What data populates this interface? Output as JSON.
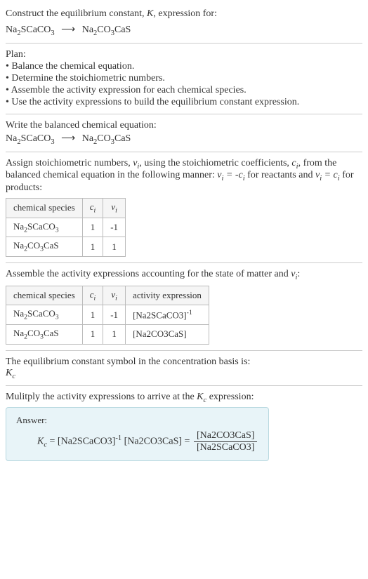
{
  "title": {
    "line1_pre": "Construct the equilibrium constant, ",
    "line1_k": "K",
    "line1_post": ", expression for:",
    "eq_lhs": "Na2SCaCO3",
    "eq_arrow": "⟶",
    "eq_rhs": "Na2CO3CaS"
  },
  "plan": {
    "heading": "Plan:",
    "items": [
      "• Balance the chemical equation.",
      "• Determine the stoichiometric numbers.",
      "• Assemble the activity expression for each chemical species.",
      "• Use the activity expressions to build the equilibrium constant expression."
    ]
  },
  "balanced": {
    "heading": "Write the balanced chemical equation:",
    "eq_lhs": "Na2SCaCO3",
    "eq_arrow": "⟶",
    "eq_rhs": "Na2CO3CaS"
  },
  "assign": {
    "text_pre": "Assign stoichiometric numbers, ",
    "nu": "ν",
    "nu_sub": "i",
    "text_mid1": ", using the stoichiometric coefficients, ",
    "c": "c",
    "c_sub": "i",
    "text_mid2": ", from the balanced chemical equation in the following manner: ",
    "rule1": "νᵢ = -cᵢ",
    "text_for_reactants": " for reactants and ",
    "rule2": "νᵢ = cᵢ",
    "text_for_products": " for products:"
  },
  "table1": {
    "headers": {
      "species": "chemical species",
      "c": "c",
      "c_sub": "i",
      "nu": "ν",
      "nu_sub": "i"
    },
    "rows": [
      {
        "species": "Na2SCaCO3",
        "c": "1",
        "nu": "-1"
      },
      {
        "species": "Na2CO3CaS",
        "c": "1",
        "nu": "1"
      }
    ]
  },
  "assemble": {
    "text_pre": "Assemble the activity expressions accounting for the state of matter and ",
    "nu": "ν",
    "nu_sub": "i",
    "text_post": ":"
  },
  "table2": {
    "headers": {
      "species": "chemical species",
      "c": "c",
      "c_sub": "i",
      "nu": "ν",
      "nu_sub": "i",
      "activity": "activity expression"
    },
    "rows": [
      {
        "species": "Na2SCaCO3",
        "c": "1",
        "nu": "-1",
        "activity_base": "[Na2SCaCO3]",
        "activity_exp": "-1"
      },
      {
        "species": "Na2CO3CaS",
        "c": "1",
        "nu": "1",
        "activity_base": "[Na2CO3CaS]",
        "activity_exp": ""
      }
    ]
  },
  "symbol": {
    "text": "The equilibrium constant symbol in the concentration basis is:",
    "k": "K",
    "k_sub": "c"
  },
  "multiply": {
    "text_pre": "Mulitply the activity expressions to arrive at the ",
    "k": "K",
    "k_sub": "c",
    "text_post": " expression:"
  },
  "answer": {
    "label": "Answer:",
    "k": "K",
    "k_sub": "c",
    "eq": " = ",
    "term1_base": "[Na2SCaCO3]",
    "term1_exp": "-1",
    "term2": " [Na2CO3CaS] = ",
    "frac_num": "[Na2CO3CaS]",
    "frac_den": "[Na2SCaCO3]"
  }
}
